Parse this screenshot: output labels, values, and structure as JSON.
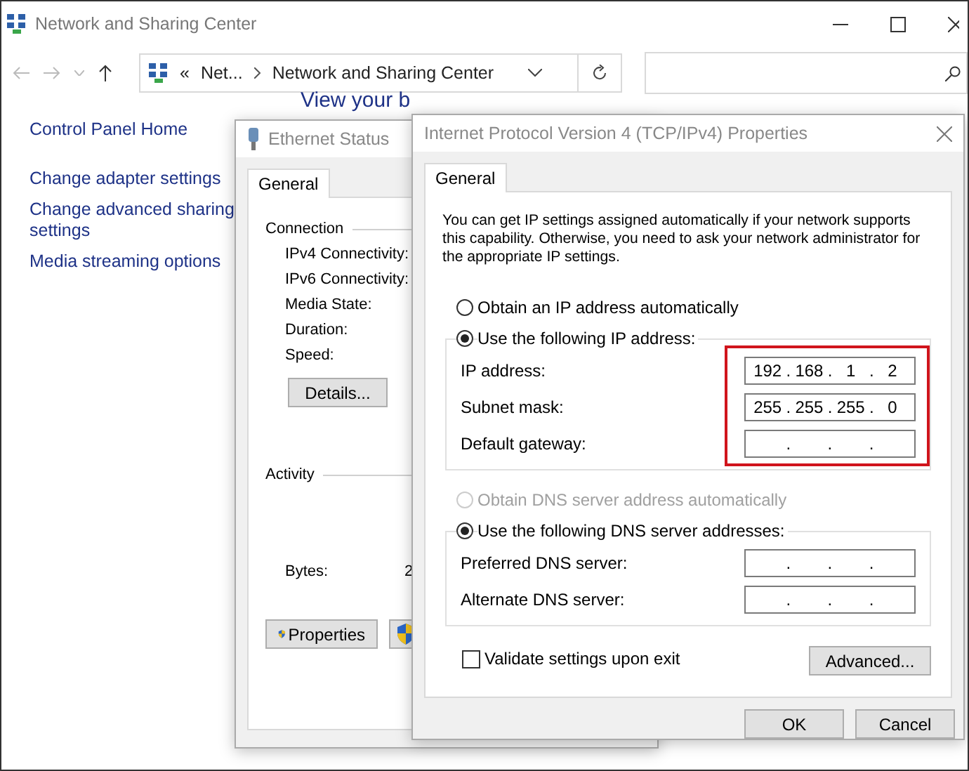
{
  "window": {
    "title": "Network and Sharing Center"
  },
  "address_bar": {
    "prefix": "«",
    "path": [
      "Net...",
      "Network and Sharing Center"
    ]
  },
  "sidebar": {
    "items": [
      "Control Panel Home",
      "Change adapter settings",
      "Change advanced sharing settings",
      "Media streaming options"
    ]
  },
  "heading": "View your b",
  "ethernet_status": {
    "title": "Ethernet Status",
    "tabs": [
      {
        "label": "General",
        "selected": true
      }
    ],
    "connection": {
      "label": "Connection",
      "fields": [
        "IPv4 Connectivity:",
        "IPv6 Connectivity:",
        "Media State:",
        "Duration:",
        "Speed:"
      ]
    },
    "details_button": "Details...",
    "activity": {
      "label": "Activity",
      "bytes_label": "Bytes:",
      "bytes_value": "2"
    },
    "properties_button": "Properties"
  },
  "ipv4_dialog": {
    "title": "Internet Protocol Version 4 (TCP/IPv4) Properties",
    "tabs": [
      {
        "label": "General",
        "selected": true
      }
    ],
    "intro": "You can get IP settings assigned automatically if your network supports this capability. Otherwise, you need to ask your network administrator for the appropriate IP settings.",
    "ip_options": [
      {
        "label": "Obtain an IP address automatically",
        "selected": false,
        "disabled": false
      },
      {
        "label": "Use the following IP address:",
        "selected": true,
        "disabled": false
      }
    ],
    "ip_fields": [
      {
        "label": "IP address:",
        "octets": [
          "192",
          "168",
          "1",
          "2"
        ]
      },
      {
        "label": "Subnet mask:",
        "octets": [
          "255",
          "255",
          "255",
          "0"
        ]
      },
      {
        "label": "Default gateway:"
      }
    ],
    "ip_fields_highlighted": true,
    "octet_separator": ".",
    "dns_options": [
      {
        "label": "Obtain DNS server address automatically",
        "selected": false,
        "disabled": true
      },
      {
        "label": "Use the following DNS server addresses:",
        "selected": true,
        "disabled": false
      }
    ],
    "dns_fields": [
      {
        "label": "Preferred DNS server:"
      },
      {
        "label": "Alternate DNS server:"
      }
    ],
    "validate": {
      "label": "Validate settings upon exit",
      "checked": false
    },
    "advanced_button": "Advanced...",
    "buttons": [
      "OK",
      "Cancel"
    ]
  }
}
